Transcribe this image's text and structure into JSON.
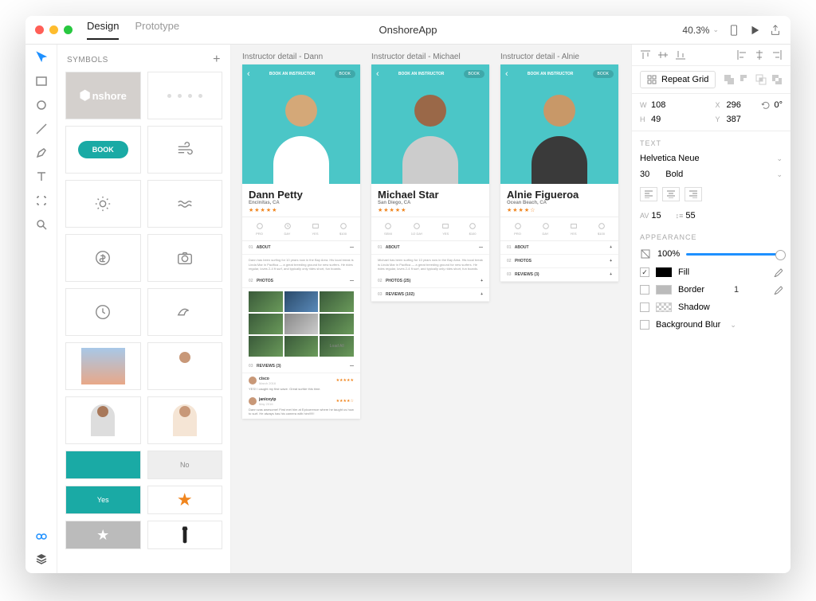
{
  "titlebar": {
    "tabs": {
      "design": "Design",
      "prototype": "Prototype"
    },
    "doc_title": "OnshoreApp",
    "zoom": "40.3%"
  },
  "symbols": {
    "heading": "SYMBOLS",
    "logo_text": "nshore",
    "book_label": "BOOK",
    "yes_label": "Yes",
    "no_label": "No"
  },
  "artboards": [
    {
      "label": "Instructor detail - Dann",
      "hero_title": "BOOK AN INSTRUCTOR",
      "hero_book": "BOOK",
      "name": "Dann Petty",
      "location": "Encinitas, CA",
      "stats": [
        "PRO",
        "DAY",
        "YES",
        "$100"
      ],
      "about_num": "01",
      "about_label": "ABOUT",
      "about_body": "Dann has been surfing for 10 years now in the Bay Area. His local break is Linda Mar in Pacifica — a great breeding ground for new surfers. He rides regular, loves 2-4 ft surf, and typically only rides short, fun boards.",
      "photos_num": "02",
      "photos_label": "PHOTOS",
      "load_all": "Load All",
      "reviews_num": "03",
      "reviews_label": "REVIEWS (3)",
      "reviews": [
        {
          "name": "cisco",
          "date": "March 2016",
          "body": "YES! I caught my first wave. Great surfde this time."
        },
        {
          "name": "janiceyip",
          "date": "May 2016",
          "body": "Dann was awesome! First met him at Epicurrence where he taught us how to surf. He always has his camera with him!!!!!!"
        }
      ]
    },
    {
      "label": "Instructor detail - Michael",
      "hero_title": "BOOK AN INSTRUCTOR",
      "hero_book": "BOOK",
      "name": "Michael Star",
      "location": "San Diego, CA",
      "stats": [
        "SEMI",
        "1/2 DAY",
        "YES",
        "$100"
      ],
      "about_num": "01",
      "about_label": "ABOUT",
      "about_body": "Michael has been surfing for 10 years now in the Bay Area. His local break is Linda Mar in Pacifica — a great breeding ground for new surfers. He rides regular, loves 2-4 ft surf, and typically only rides short, fun boards.",
      "photos_num": "02",
      "photos_label": "PHOTOS (25)",
      "reviews_num": "03",
      "reviews_label": "REVIEWS (102)"
    },
    {
      "label": "Instructor detail - Alnie",
      "hero_title": "BOOK AN INSTRUCTOR",
      "hero_book": "BOOK",
      "name": "Alnie Figueroa",
      "location": "Ocean Beach, CA",
      "stats": [
        "PRO",
        "DAY",
        "YES",
        "$100"
      ],
      "about_num": "01",
      "about_label": "ABOUT",
      "photos_num": "02",
      "photos_label": "PHOTOS",
      "reviews_num": "03",
      "reviews_label": "REVIEWS (3)"
    }
  ],
  "inspector": {
    "repeat_grid": "Repeat Grid",
    "dims": {
      "w_lbl": "W",
      "w": "108",
      "h_lbl": "H",
      "h": "49",
      "x_lbl": "X",
      "x": "296",
      "y_lbl": "Y",
      "y": "387",
      "rotate": "0°"
    },
    "text": {
      "heading": "TEXT",
      "font": "Helvetica Neue",
      "size": "30",
      "weight": "Bold",
      "tracking_lbl": "AV",
      "tracking": "15",
      "leading_lbl": "↕≡",
      "leading": "55"
    },
    "appearance": {
      "heading": "APPEARANCE",
      "opacity": "100%",
      "fill": "Fill",
      "border": "Border",
      "border_val": "1",
      "shadow": "Shadow",
      "bgblur": "Background Blur"
    }
  }
}
